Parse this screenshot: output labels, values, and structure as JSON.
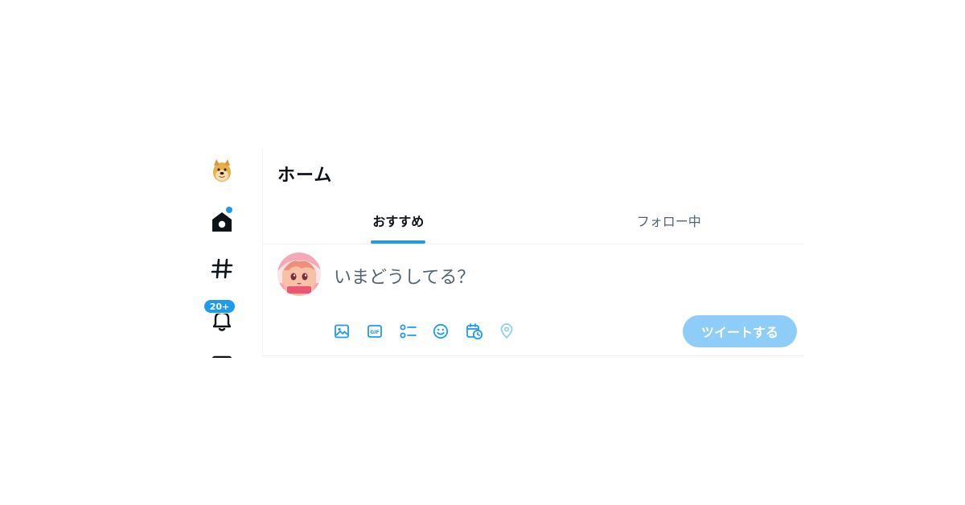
{
  "header": {
    "title": "ホーム"
  },
  "tabs": [
    {
      "label": "おすすめ",
      "active": true
    },
    {
      "label": "フォロー中",
      "active": false
    }
  ],
  "nav": {
    "items": [
      {
        "name": "logo",
        "icon": "doge-logo-icon"
      },
      {
        "name": "home",
        "icon": "home-icon",
        "has_dot": true
      },
      {
        "name": "explore",
        "icon": "hashtag-icon"
      },
      {
        "name": "notifications",
        "icon": "bell-icon",
        "badge": "20+"
      },
      {
        "name": "messages",
        "icon": "mail-icon"
      }
    ]
  },
  "composer": {
    "placeholder": "いまどうしてる？",
    "tools": [
      "image-icon",
      "gif-icon",
      "poll-icon",
      "emoji-icon",
      "schedule-icon",
      "location-icon"
    ],
    "tweet_button_label": "ツイートする"
  },
  "colors": {
    "accent": "#1d9bf0",
    "tweet_button_disabled": "#8ecdf7",
    "text_primary": "#0f1419",
    "text_secondary": "#536471",
    "border": "#eff3f4"
  }
}
